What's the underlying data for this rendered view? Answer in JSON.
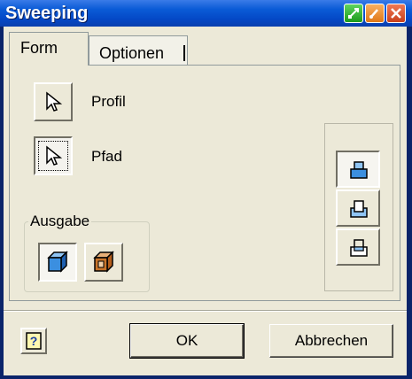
{
  "window": {
    "title": "Sweeping"
  },
  "tabs": [
    {
      "label": "Form",
      "active": true
    },
    {
      "label": "Optionen",
      "active": false
    }
  ],
  "form": {
    "profil_label": "Profil",
    "pfad_label": "Pfad",
    "output_group_label": "Ausgabe"
  },
  "buttons": {
    "ok_label": "OK",
    "cancel_label": "Abbrechen"
  },
  "colors": {
    "titlebar": "#0a5bd6",
    "dialog_bg": "#ece9d8",
    "solid_icon": "#3b8fe0",
    "surface_icon": "#c8742a"
  },
  "icons": {
    "profil_select": "cursor-arrow-icon",
    "pfad_select": "cursor-arrow-icon",
    "output_solid": "solid-cube-icon",
    "output_surface": "surface-cube-icon",
    "operation_join": "join-icon",
    "operation_cut": "cut-icon",
    "operation_intersect": "intersect-icon",
    "help": "help-icon"
  }
}
